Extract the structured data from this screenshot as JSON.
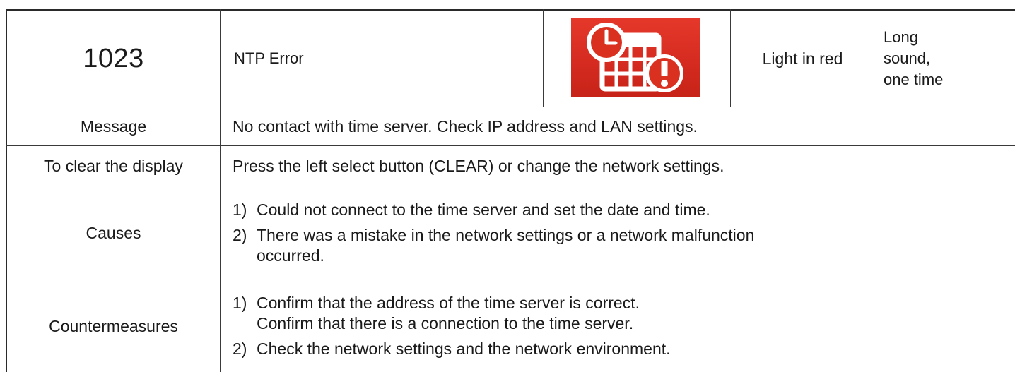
{
  "header_row": {
    "code": "1023",
    "error_name": "NTP Error",
    "icon": "calendar-clock-warning-icon",
    "icon_color": "#d9301f",
    "light": "Light in red",
    "sound_lines": [
      "Long",
      "sound,",
      "one time"
    ]
  },
  "rows": {
    "message": {
      "label": "Message",
      "text": "No contact with time server. Check IP address and LAN settings."
    },
    "clear": {
      "label": "To clear the display",
      "text": "Press the left select button (CLEAR) or change the network settings."
    },
    "causes": {
      "label": "Causes",
      "items": [
        {
          "num": "1)",
          "lines": [
            "Could not connect to the time server and set the date and time."
          ]
        },
        {
          "num": "2)",
          "lines": [
            "There was a mistake in the network settings or a network malfunction",
            "occurred."
          ]
        }
      ]
    },
    "countermeasures": {
      "label": "Countermeasures",
      "items": [
        {
          "num": "1)",
          "lines": [
            "Confirm that the address of the time server is correct.",
            "Confirm that there is a connection to the time server."
          ]
        },
        {
          "num": "2)",
          "lines": [
            "Check the network settings and the network environment."
          ]
        }
      ]
    }
  }
}
